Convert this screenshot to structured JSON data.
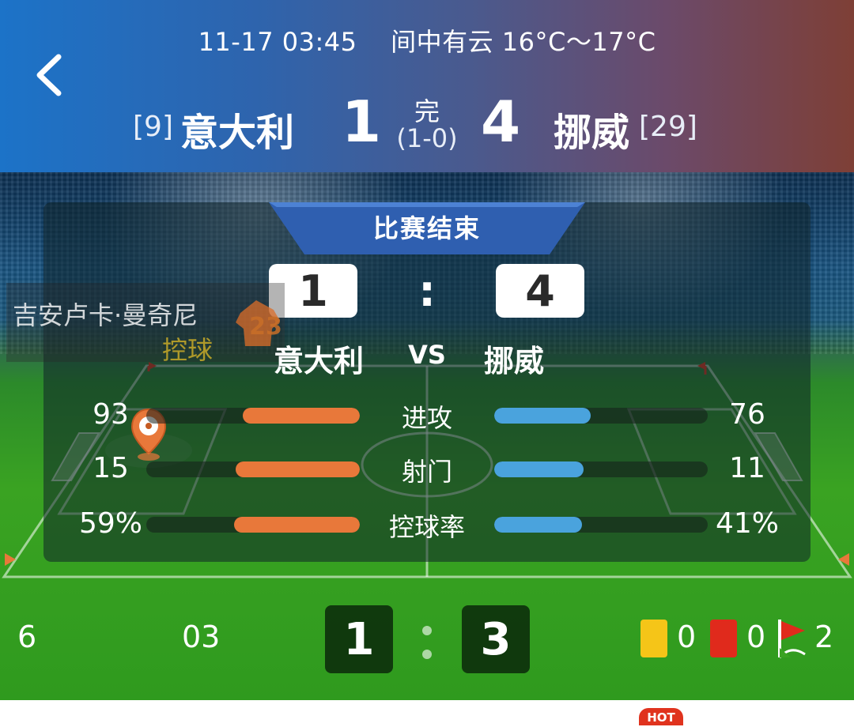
{
  "header": {
    "datetime": "11-17 03:45",
    "weather": "间中有云 16°C～17°C",
    "home": {
      "rank": "[9]",
      "name": "意大利",
      "score": "1"
    },
    "away": {
      "rank": "[29]",
      "name": "挪威",
      "score": "4"
    },
    "status": "完",
    "half_time": "(1-0)"
  },
  "panel": {
    "tab_label": "比赛结束",
    "home_score": "1",
    "away_score": "4",
    "colon": ":",
    "home_name": "意大利",
    "vs": "VS",
    "away_name": "挪威"
  },
  "event_overlay": {
    "player_name": "吉安卢卡·曼奇尼",
    "player_number": "23",
    "action": "控球"
  },
  "stats": [
    {
      "label": "进攻",
      "home": "93",
      "away": "76",
      "home_fill": 0.55,
      "away_fill": 0.45
    },
    {
      "label": "射门",
      "home": "15",
      "away": "11",
      "home_fill": 0.58,
      "away_fill": 0.42
    },
    {
      "label": "控球率",
      "home": "59%",
      "away": "41%",
      "home_fill": 0.59,
      "away_fill": 0.41
    }
  ],
  "bottom": {
    "left_a": "6",
    "left_b": "03",
    "home_goals": "1",
    "away_goals": "3",
    "yellow_cards": "0",
    "red_cards": "0",
    "corners": "2"
  },
  "badge": {
    "hot": "HOT"
  },
  "colors": {
    "home_bar": "#e8783a",
    "away_bar": "#4aa3dd",
    "yellow_card": "#f5c518",
    "red_card": "#e02a1c",
    "hot_badge": "#e0331e"
  }
}
